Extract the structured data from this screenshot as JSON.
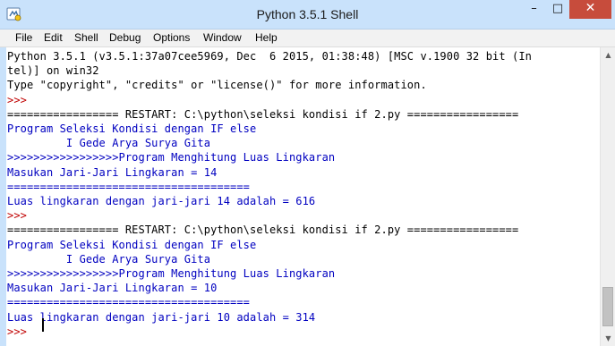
{
  "window": {
    "title": "Python 3.5.1 Shell",
    "controls": {
      "minimize": "–",
      "maximize": "□",
      "close": "✕"
    },
    "app_icon": "python-idle-icon"
  },
  "menu": {
    "items": [
      "File",
      "Edit",
      "Shell",
      "Debug",
      "Options",
      "Window",
      "Help"
    ]
  },
  "shell": {
    "lines": [
      {
        "text": "Python 3.5.1 (v3.5.1:37a07cee5969, Dec  6 2015, 01:38:48) [MSC v.1900 32 bit (In",
        "kind": "out"
      },
      {
        "text": "tel)] on win32",
        "kind": "out"
      },
      {
        "text": "Type \"copyright\", \"credits\" or \"license()\" for more information.",
        "kind": "out"
      },
      {
        "text": ">>>",
        "kind": "prompt"
      },
      {
        "text": "================= RESTART: C:\\python\\seleksi kondisi if 2.py =================",
        "kind": "out"
      },
      {
        "text": "Program Seleksi Kondisi dengan IF else",
        "kind": "stdout"
      },
      {
        "text": "         I Gede Arya Surya Gita",
        "kind": "stdout"
      },
      {
        "text": ">>>>>>>>>>>>>>>>>Program Menghitung Luas Lingkaran",
        "kind": "stdout"
      },
      {
        "text": "Masukan Jari-Jari Lingkaran = 14",
        "kind": "stdout"
      },
      {
        "text": "=====================================",
        "kind": "stdout"
      },
      {
        "text": "Luas lingkaran dengan jari-jari 14 adalah = 616",
        "kind": "stdout"
      },
      {
        "text": ">>>",
        "kind": "prompt"
      },
      {
        "text": "================= RESTART: C:\\python\\seleksi kondisi if 2.py =================",
        "kind": "out"
      },
      {
        "text": "Program Seleksi Kondisi dengan IF else",
        "kind": "stdout"
      },
      {
        "text": "         I Gede Arya Surya Gita",
        "kind": "stdout"
      },
      {
        "text": ">>>>>>>>>>>>>>>>>Program Menghitung Luas Lingkaran",
        "kind": "stdout"
      },
      {
        "text": "Masukan Jari-Jari Lingkaran = 10",
        "kind": "stdout"
      },
      {
        "text": "=====================================",
        "kind": "stdout"
      },
      {
        "text": "Luas lingkaran dengan jari-jari 10 adalah = 314",
        "kind": "stdout"
      },
      {
        "text": ">>>",
        "kind": "prompt"
      }
    ]
  },
  "colors": {
    "titlebar": "#c9e2fb",
    "prompt": "#c00000",
    "stdout": "#0000c0",
    "output": "#000000",
    "close_button": "#c74c3c"
  }
}
